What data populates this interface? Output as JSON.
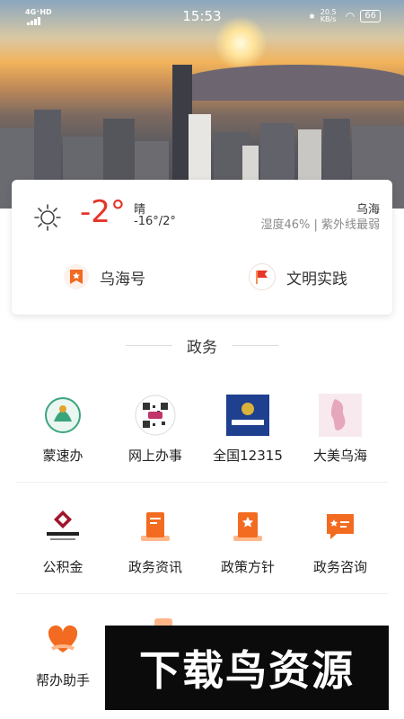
{
  "status_bar": {
    "network": "4G⁺HD",
    "time": "15:53",
    "speed": "20.5 KB/s",
    "battery": "66"
  },
  "weather": {
    "icon": "sun-icon",
    "temperature": "-2°",
    "condition": "晴",
    "range": "-16°/2°",
    "city": "乌海",
    "detail": "湿度46% | 紫外线最弱"
  },
  "shortcuts": [
    {
      "label": "乌海号",
      "icon": "bookmark-icon"
    },
    {
      "label": "文明实践",
      "icon": "flag-icon"
    }
  ],
  "section": {
    "title": "政务"
  },
  "services": [
    {
      "label": "蒙速办"
    },
    {
      "label": "网上办事"
    },
    {
      "label": "全国12315"
    },
    {
      "label": "大美乌海"
    },
    {
      "label": "公积金"
    },
    {
      "label": "政务资讯"
    },
    {
      "label": "政策方针"
    },
    {
      "label": "政务咨询"
    },
    {
      "label": "帮办助手"
    }
  ],
  "watermark": {
    "text": "下载鸟资源"
  },
  "colors": {
    "accent": "#f26b21",
    "temp": "#e5342a"
  }
}
